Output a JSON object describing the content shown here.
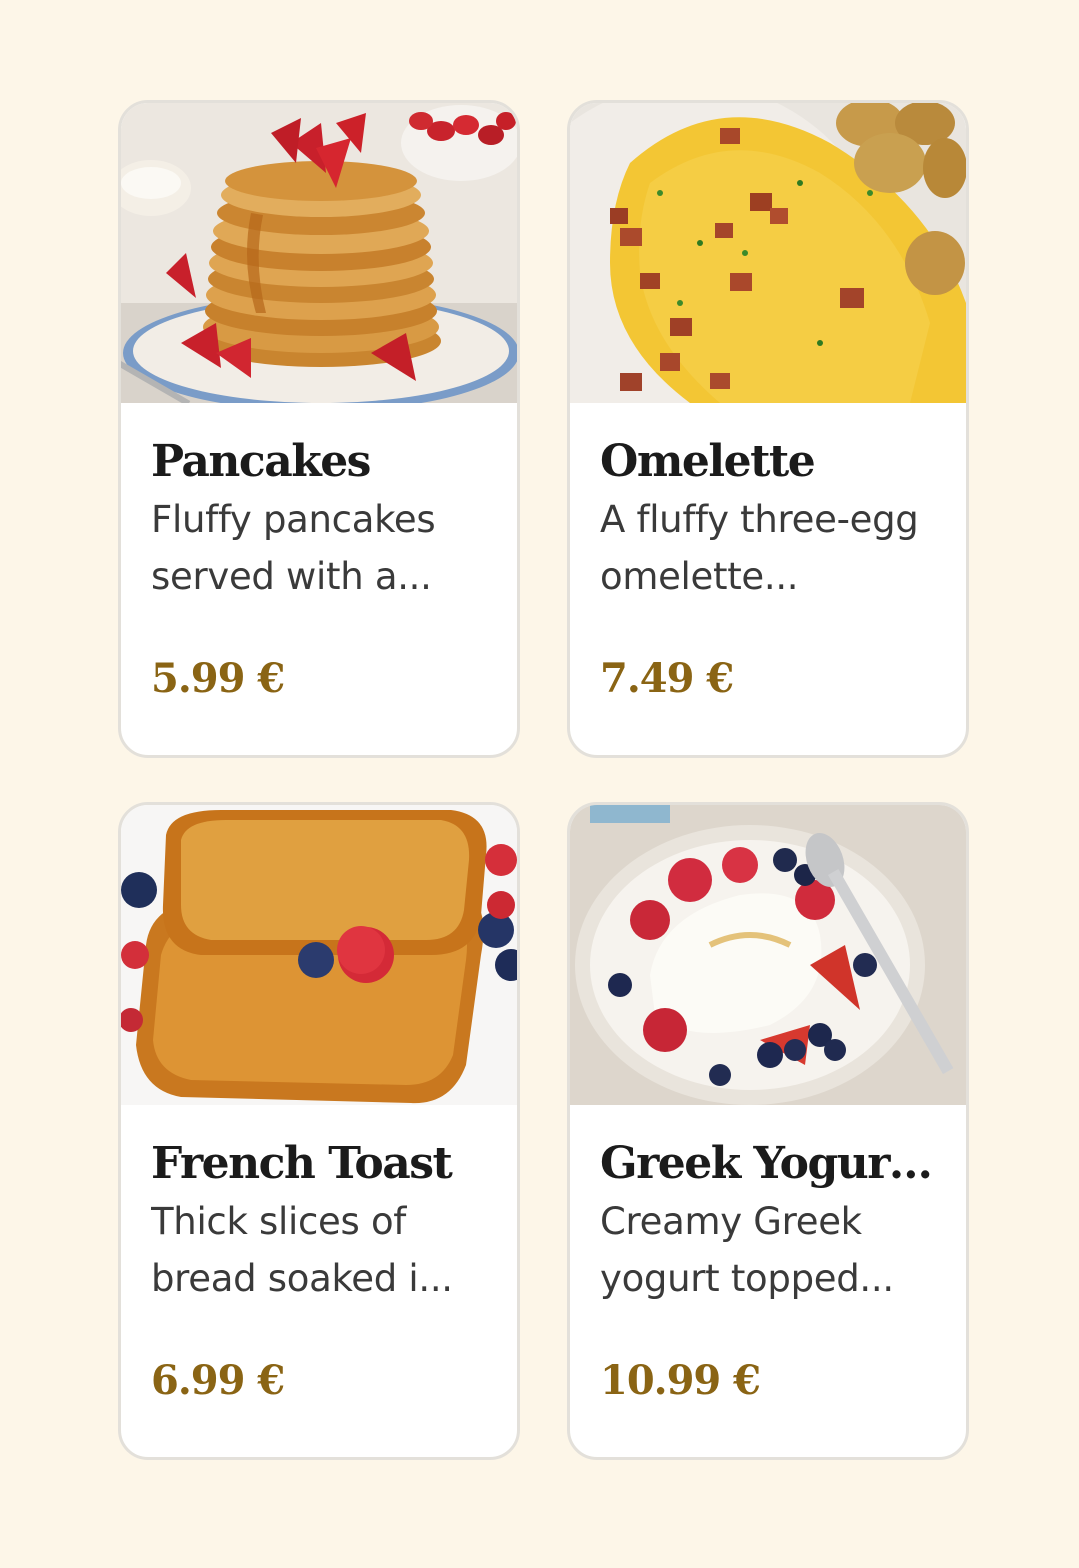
{
  "menu": {
    "items": [
      {
        "name": "Pancakes",
        "description": "Fluffy pancakes served with a...",
        "price": "5.99 €",
        "image": "pancakes-photo"
      },
      {
        "name": "Omelette",
        "description": "A fluffy three-egg omelette...",
        "price": "7.49 €",
        "image": "omelette-photo"
      },
      {
        "name": "French Toast",
        "description": "Thick slices of bread soaked i...",
        "price": "6.99 €",
        "image": "french-toast-photo"
      },
      {
        "name": "Greek Yogurt ...",
        "description": "Creamy Greek yogurt topped...",
        "price": "10.99 €",
        "image": "greek-yogurt-photo"
      }
    ]
  },
  "colors": {
    "page_background": "#fdf6e8",
    "card_background": "#ffffff",
    "card_border": "#e3e0da",
    "title_text": "#1b1b1b",
    "description_text": "#3a3a3a",
    "price_text": "#8a6414"
  }
}
